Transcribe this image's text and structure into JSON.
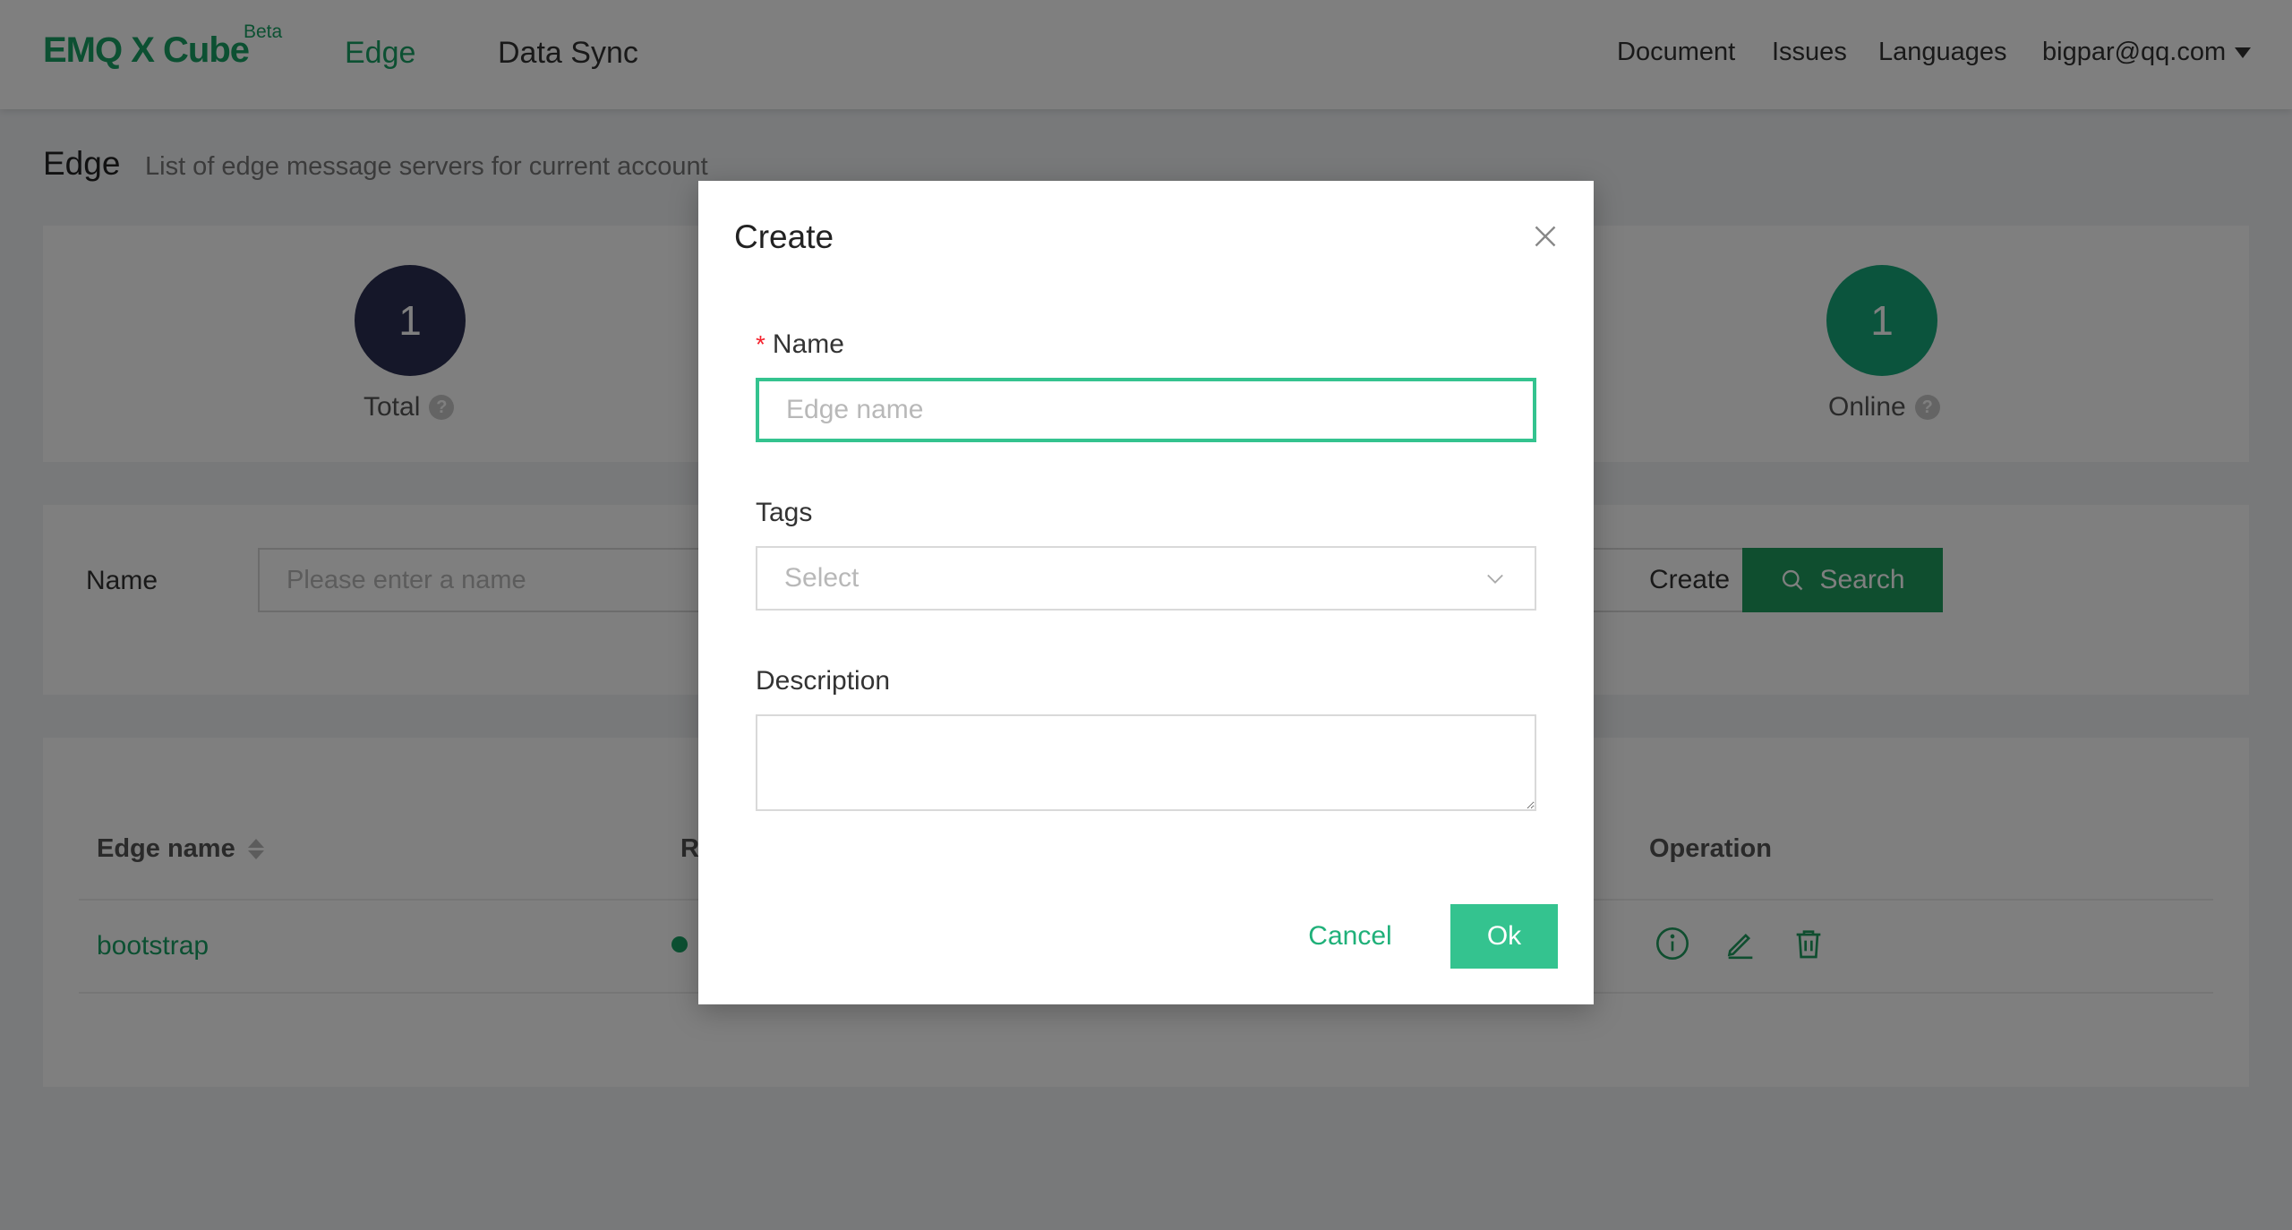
{
  "header": {
    "logo": "EMQ X Cube",
    "logo_badge": "Beta",
    "nav": {
      "edge": "Edge",
      "data_sync": "Data Sync"
    },
    "right_nav": {
      "document": "Document",
      "issues": "Issues",
      "languages": "Languages",
      "user": "bigpar@qq.com"
    }
  },
  "page": {
    "title": "Edge",
    "subtitle": "List of edge message servers for current account"
  },
  "stats": {
    "total": {
      "value": "1",
      "label": "Total",
      "color": "#2b2f52"
    },
    "online": {
      "value": "1",
      "label": "Online",
      "color": "#17a87b"
    }
  },
  "search": {
    "label": "Name",
    "placeholder": "Please enter a name",
    "create_label": "Create",
    "search_label": "Search"
  },
  "table": {
    "columns": {
      "name": "Edge name",
      "partial": "R",
      "operation": "Operation"
    },
    "rows": [
      {
        "name": "bootstrap",
        "status_color": "#18a164"
      }
    ]
  },
  "modal": {
    "title": "Create",
    "name_label": "Name",
    "required_mark": "*",
    "name_placeholder": "Edge name",
    "tags_label": "Tags",
    "tags_placeholder": "Select",
    "description_label": "Description",
    "cancel_label": "Cancel",
    "ok_label": "Ok"
  },
  "colors": {
    "brand": "#18a164",
    "primary_button": "#34c38f",
    "search_button": "#1f9d5f",
    "required": "#f5222d"
  }
}
